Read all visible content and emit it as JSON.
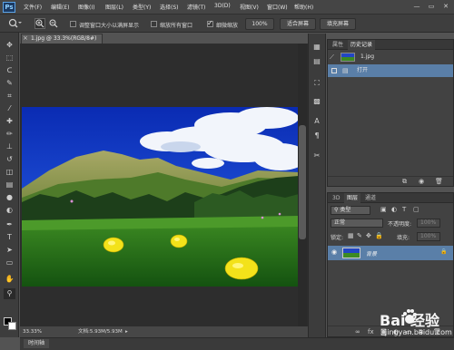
{
  "app": {
    "logo": "Ps"
  },
  "menubar": {
    "items": [
      "文件(F)",
      "编辑(E)",
      "图像(I)",
      "图层(L)",
      "类型(Y)",
      "选择(S)",
      "滤镜(T)",
      "3D(D)",
      "视图(V)",
      "窗口(W)",
      "帮助(H)"
    ],
    "window_controls": [
      "—",
      "▭",
      "✕"
    ]
  },
  "options": {
    "resize_windows_label": "调整窗口大小以满屏显示",
    "zoom_all_label": "缩放所有窗口",
    "scrubby_zoom_label": "细微缩放",
    "zoom_100": "100%",
    "fit_screen": "适合屏幕",
    "fill_screen": "填充屏幕",
    "resize_windows_checked": false,
    "zoom_all_checked": false,
    "scrubby_zoom_checked": true
  },
  "document": {
    "tab_title": "1.jpg @ 33.3%(RGB/8#)",
    "close": "×"
  },
  "status": {
    "zoom": "33.33%",
    "doc_info": "文档:5.93M/5.93M"
  },
  "timeline": {
    "tab": "时间轴"
  },
  "history_panel": {
    "tabs": [
      "属性",
      "历史记录"
    ],
    "snapshot_label": "1.jpg",
    "steps": [
      "打开"
    ]
  },
  "layers_panel": {
    "tabs": [
      "3D",
      "图层",
      "通道"
    ],
    "filter_kind": "类型",
    "blend_mode": "正常",
    "opacity_label": "不透明度:",
    "opacity_value": "100%",
    "lock_label": "锁定:",
    "fill_label": "填充:",
    "fill_value": "100%",
    "layer_name": "背景"
  },
  "watermark": {
    "brand": "Bai 经验",
    "url": "jingyan.baidu.com"
  },
  "colors": {
    "accent_selection": "#5a7fa8",
    "ui_dark": "#3d3d3d",
    "ui_mid": "#535353"
  },
  "icons": {
    "tools": [
      "move-icon",
      "marquee-icon",
      "lasso-icon",
      "quick-select-icon",
      "crop-icon",
      "eyedropper-icon",
      "healing-icon",
      "brush-icon",
      "clone-stamp-icon",
      "history-brush-icon",
      "eraser-icon",
      "gradient-icon",
      "blur-icon",
      "dodge-icon",
      "pen-icon",
      "type-icon",
      "path-select-icon",
      "rectangle-icon",
      "hand-icon",
      "zoom-icon"
    ]
  }
}
